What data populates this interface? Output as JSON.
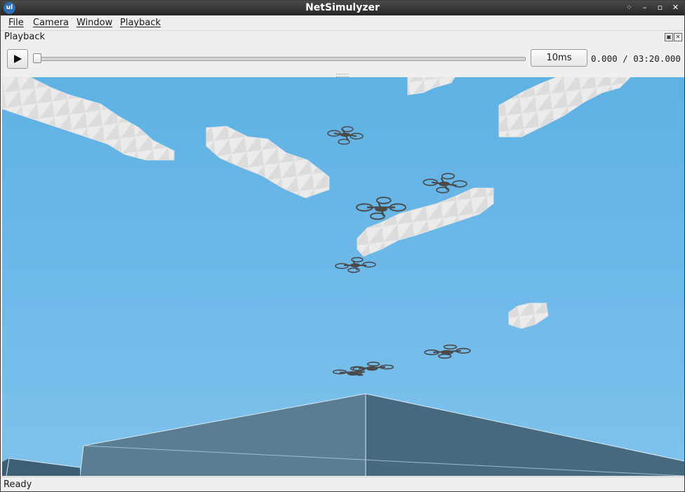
{
  "window": {
    "title": "NetSimulyzer",
    "app_icon_glyph": "ul",
    "controls": [
      "restore-icon",
      "minimize-icon",
      "maximize-icon",
      "close-icon"
    ]
  },
  "menu": {
    "file": "File",
    "camera": "Camera",
    "window": "Window",
    "playback": "Playback"
  },
  "dock": {
    "title": "Playback",
    "float_icon": "float-icon",
    "close_icon": "close-icon"
  },
  "playback": {
    "play_icon": "play-icon",
    "progress": 0,
    "speed_label": "10ms",
    "time_readout": "0.000 / 03:20.000"
  },
  "scene": {
    "sky_color": "#65b5e6",
    "cloud_color": "#f4f4f4",
    "building_color": "#4f7287",
    "drone_color": "#4a4a4a",
    "drone_count": 8,
    "cloud_count": 6
  },
  "status": {
    "text": "Ready"
  }
}
